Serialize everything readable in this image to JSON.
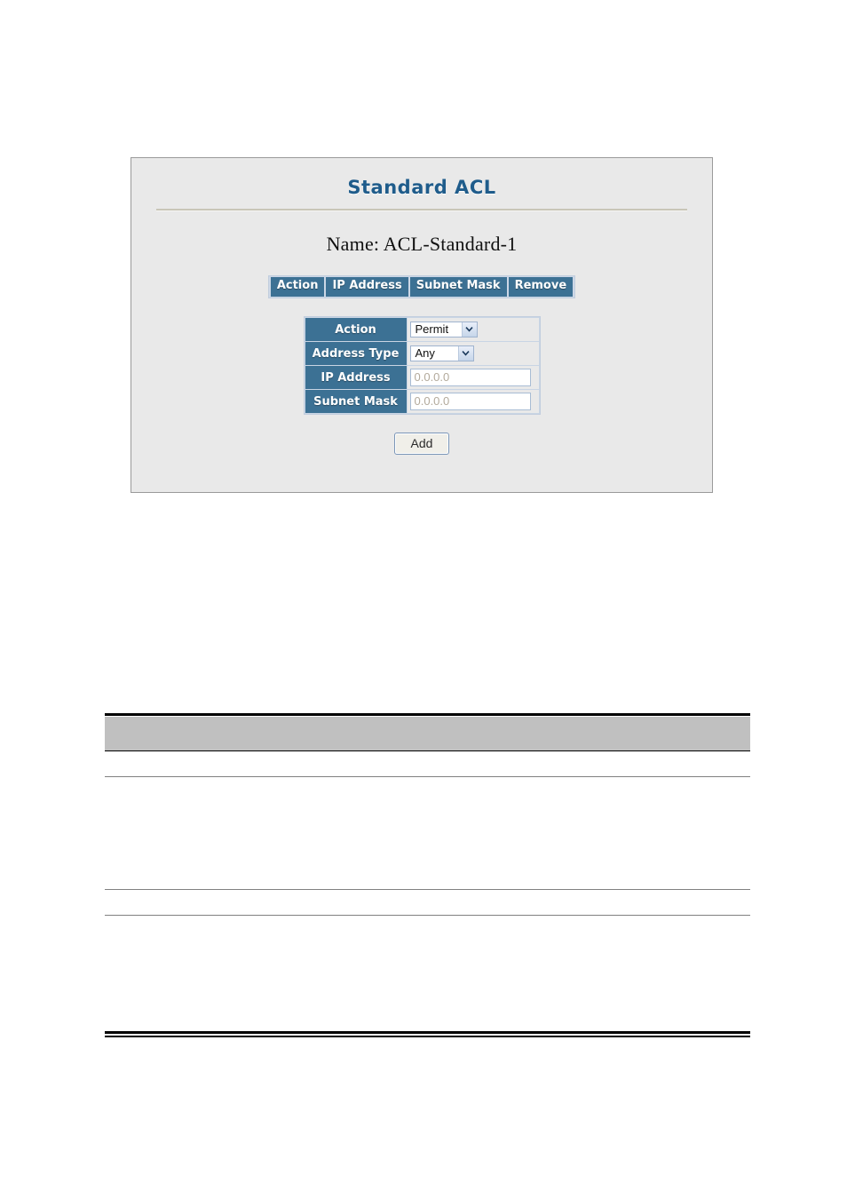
{
  "panel": {
    "title": "Standard ACL",
    "name_line": "Name: ACL-Standard-1",
    "column_headers": [
      "Action",
      "IP Address",
      "Subnet Mask",
      "Remove"
    ],
    "form": {
      "rows": [
        {
          "label": "Action",
          "control": "select",
          "value": "Permit"
        },
        {
          "label": "Address Type",
          "control": "select",
          "value": "Any"
        },
        {
          "label": "IP Address",
          "control": "text",
          "value": "0.0.0.0"
        },
        {
          "label": "Subnet Mask",
          "control": "text",
          "value": "0.0.0.0"
        }
      ]
    },
    "add_button": "Add"
  },
  "icons": {
    "dropdown_arrow": "chevron-down-icon"
  },
  "colors": {
    "panel_background": "#e9e9e9",
    "panel_border": "#9a9a9a",
    "title_text": "#1f5c8b",
    "header_cell": "#3c7194",
    "header_cell_text": "#ffffff",
    "input_placeholder_text": "#b3aa9c",
    "doc_table_band": "#c0c0c0",
    "doc_table_rule": "#000000"
  },
  "doc_table": {
    "header_band_text": "",
    "rows": []
  }
}
